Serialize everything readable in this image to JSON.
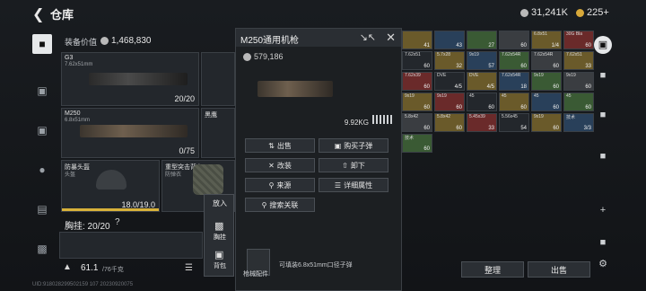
{
  "header": {
    "title": "仓库",
    "silver": "31,241K",
    "gold": "225+"
  },
  "equipment": {
    "value_label": "装备价值",
    "value": "1,468,830",
    "primary": {
      "name": "G3",
      "caliber": "7.62x51mm",
      "ammo": "20/20"
    },
    "secondary": {
      "name": "M250",
      "caliber": "6.8x51mm",
      "ammo": "0/75"
    },
    "melee_label": "黑鹰",
    "helmet": {
      "name": "防暴头盔",
      "sub": "头盔",
      "durability": "18.0/19.0"
    },
    "armor": {
      "name": "重型突击背心",
      "sub": "防弹衣"
    },
    "chest_label": "胸挂: 20/20",
    "weight": "61.1",
    "weight_max": "/76千克"
  },
  "popup": {
    "put_in": "放入",
    "chest": "胸挂",
    "backpack": "背包"
  },
  "detail": {
    "title": "M250通用机枪",
    "price": "579,186",
    "weight": "9.92KG",
    "actions": {
      "sell": "出售",
      "buy_ammo": "购买子弹",
      "modify": "改装",
      "unload": "卸下",
      "source": "来源",
      "details": "详细属性",
      "search_related": "搜索关联"
    },
    "ammo_note": "可填装6.8x51mm口径子弹",
    "attach_label": "枪械配件"
  },
  "stash": {
    "organize": "整理",
    "sell": "出售",
    "cells": [
      {
        "label": "",
        "count": "41"
      },
      {
        "label": "",
        "count": "43"
      },
      {
        "label": "",
        "count": "27"
      },
      {
        "label": "",
        "count": "60"
      },
      {
        "label": "6.8x51",
        "count": "1/4"
      },
      {
        "label": "30G Bla",
        "count": "60"
      },
      {
        "label": "7.62x51",
        "count": "60"
      },
      {
        "label": "5.7x28",
        "count": "32"
      },
      {
        "label": "9x19",
        "count": "57"
      },
      {
        "label": "7.62x54R",
        "count": "60"
      },
      {
        "label": "7.62x54R",
        "count": "60"
      },
      {
        "label": "7.62x51",
        "count": "33"
      },
      {
        "label": "7.62x39",
        "count": "60"
      },
      {
        "label": "DVE",
        "count": "4/5"
      },
      {
        "label": "DVE",
        "count": "4/5"
      },
      {
        "label": "7.62x54R",
        "count": "18"
      },
      {
        "label": "9x19",
        "count": "60"
      },
      {
        "label": "9x19",
        "count": "60"
      },
      {
        "label": "9x19",
        "count": "60"
      },
      {
        "label": "9x19",
        "count": "60"
      },
      {
        "label": "45",
        "count": "60"
      },
      {
        "label": "45",
        "count": "60"
      },
      {
        "label": "45",
        "count": "60"
      },
      {
        "label": "45",
        "count": "60"
      },
      {
        "label": "5.8x42",
        "count": "60"
      },
      {
        "label": "5.8x42",
        "count": "60"
      },
      {
        "label": "5.45x39",
        "count": "33"
      },
      {
        "label": "5.56x45",
        "count": "54"
      },
      {
        "label": "9x19",
        "count": "60"
      },
      {
        "label": "技术",
        "count": "3/3"
      },
      {
        "label": "技术",
        "count": "60"
      }
    ]
  },
  "footer": "UID:918028299502159 107 20230920075"
}
